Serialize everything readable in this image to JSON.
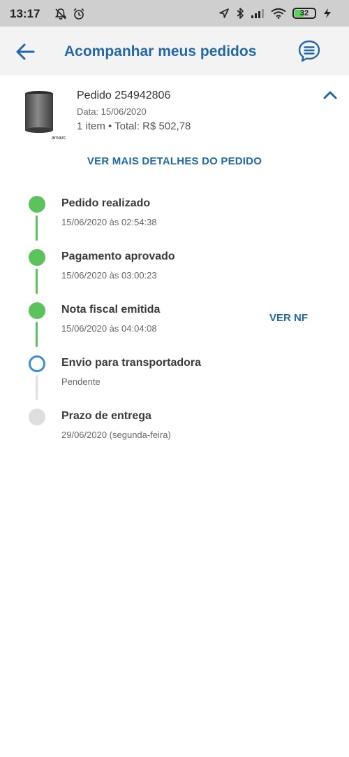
{
  "status_bar": {
    "time": "13:17",
    "battery": "32",
    "icons": [
      "notifications-off-icon",
      "alarm-icon",
      "location-arrow-icon",
      "bluetooth-icon",
      "signal-icon",
      "wifi-icon",
      "battery-icon",
      "charging-icon"
    ]
  },
  "header": {
    "title": "Acompanhar meus pedidos",
    "back_icon": "arrow-left-icon",
    "chat_icon": "chat-bubble-icon"
  },
  "order": {
    "id_label": "Pedido 254942806",
    "date_label": "Data: 15/06/2020",
    "summary_label": "1 item • Total: R$ 502,78",
    "brand_label": "amazon",
    "collapse_icon": "chevron-up-icon"
  },
  "details_link": "VER MAIS DETALHES DO PEDIDO",
  "timeline": [
    {
      "title": "Pedido realizado",
      "subtitle": "15/06/2020 às 02:54:38",
      "state": "done"
    },
    {
      "title": "Pagamento aprovado",
      "subtitle": "15/06/2020 às 03:00:23",
      "state": "done"
    },
    {
      "title": "Nota fiscal emitida",
      "subtitle": "15/06/2020 às 04:04:08",
      "state": "done",
      "action": "VER NF"
    },
    {
      "title": "Envio para transportadora",
      "subtitle": "Pendente",
      "state": "current"
    },
    {
      "title": "Prazo de entrega",
      "subtitle": "29/06/2020 (segunda-feira)",
      "state": "future"
    }
  ],
  "colors": {
    "accent": "#2268a8",
    "done": "#5cc35c",
    "current": "#3a8fd8",
    "pending": "#dedede"
  }
}
